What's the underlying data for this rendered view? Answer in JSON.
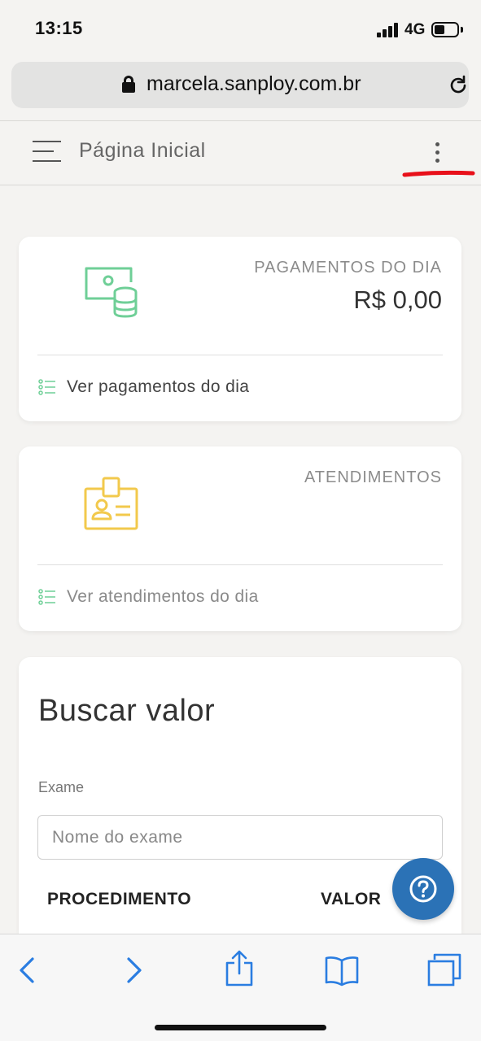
{
  "status_bar": {
    "time": "13:15",
    "network": "4G"
  },
  "browser": {
    "url": "marcela.sanploy.com.br"
  },
  "header": {
    "title": "Página Inicial"
  },
  "payments_card": {
    "label": "PAGAMENTOS DO DIA",
    "value": "R$ 0,00",
    "link": "Ver pagamentos do dia",
    "icon_color": "#6fcf97"
  },
  "appointments_card": {
    "label": "ATENDIMENTOS",
    "link": "Ver atendimentos do dia",
    "icon_color": "#f2c94c"
  },
  "search_card": {
    "title": "Buscar valor",
    "field_label": "Exame",
    "placeholder": "Nome do exame",
    "columns": [
      "PROCEDIMENTO",
      "VALOR"
    ]
  },
  "colors": {
    "accent_blue": "#2b72b6",
    "annotation_red": "#e8101a",
    "ios_blue": "#2a7de1"
  },
  "icons": [
    "lock-icon",
    "reload-icon",
    "menu-icon",
    "kebab-icon",
    "money-icon",
    "badge-icon",
    "list-icon",
    "help-icon",
    "back-icon",
    "forward-icon",
    "share-icon",
    "bookmarks-icon",
    "tabs-icon"
  ]
}
